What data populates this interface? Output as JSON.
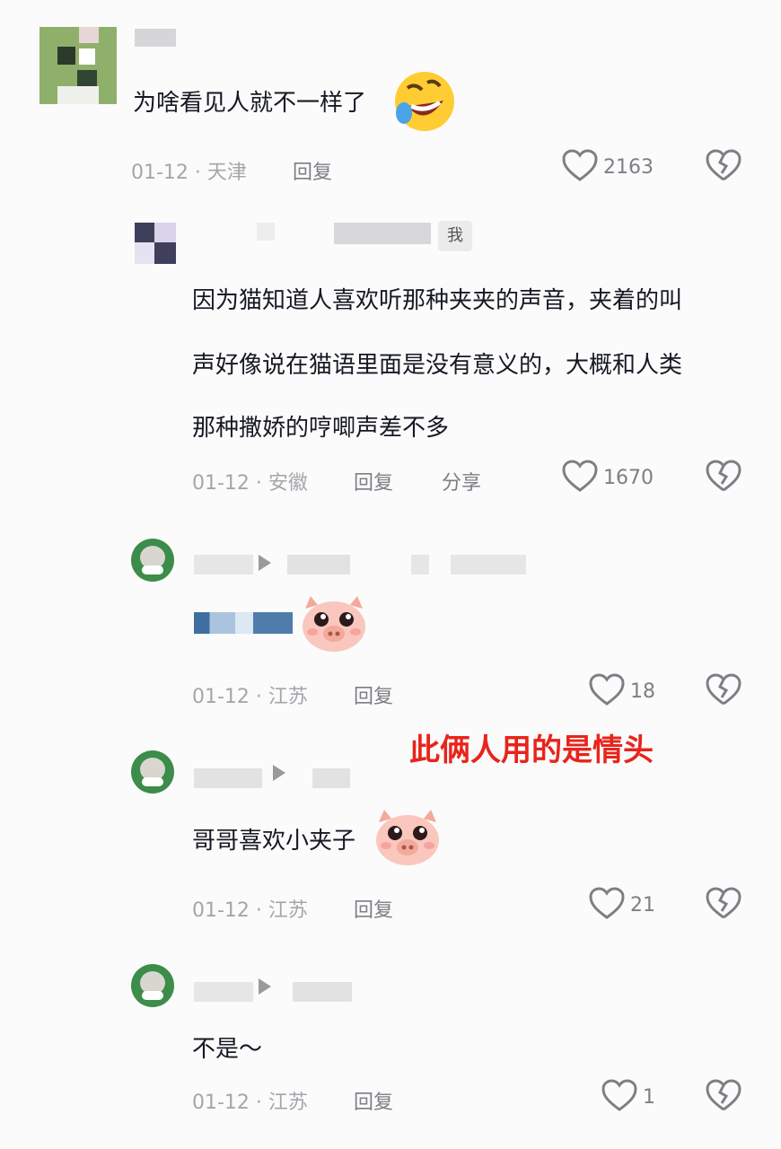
{
  "comments": [
    {
      "text": "为啥看见人就不一样了",
      "emoji": "rofl-emoji",
      "date_location": "01-12 · 天津",
      "reply_label": "回复",
      "likes": "2163"
    },
    {
      "author_badge": "我",
      "text_lines": [
        "因为猫知道人喜欢听那种夹夹的声音，夹着的叫",
        "声好像说在猫语里面是没有意义的，大概和人类",
        "那种撒娇的哼唧声差不多"
      ],
      "date_location": "01-12 · 安徽",
      "reply_label": "回复",
      "share_label": "分享",
      "likes": "1670"
    },
    {
      "emoji": "pig-face-emoji",
      "date_location": "01-12 · 江苏",
      "reply_label": "回复",
      "likes": "18"
    },
    {
      "text": "哥哥喜欢小夹子",
      "emoji": "pig-face-emoji",
      "date_location": "01-12 · 江苏",
      "reply_label": "回复",
      "likes": "21"
    },
    {
      "text": "不是～",
      "date_location": "01-12 · 江苏",
      "reply_label": "回复",
      "likes": "1"
    }
  ],
  "annotation": "此俩人用的是情头",
  "colors": {
    "annotation": "#e8241c",
    "meta": "#a4a6ab",
    "action": "#7d7f85",
    "text": "#161823"
  }
}
